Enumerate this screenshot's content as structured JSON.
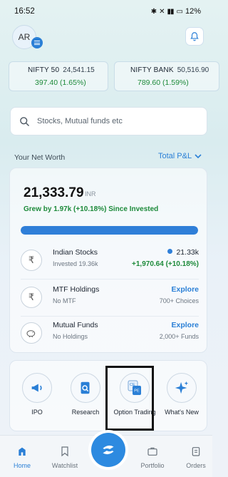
{
  "status_bar": {
    "time": "16:52",
    "battery": "12%"
  },
  "header": {
    "avatar_initials": "AR"
  },
  "indices": [
    {
      "name": "NIFTY 50",
      "price": "24,541.15",
      "change": "397.40 (1.65%)"
    },
    {
      "name": "NIFTY BANK",
      "price": "50,516.90",
      "change": "789.60 (1.59%)"
    }
  ],
  "search": {
    "placeholder": "Stocks, Mutual funds etc"
  },
  "net_worth": {
    "label": "Your Net Worth",
    "toggle": "Total P&L",
    "value": "21,333.79",
    "unit": "INR",
    "growth": "Grew by 1.97k (+10.18%) Since Invested",
    "bar_fraction": 1.0
  },
  "holdings": [
    {
      "title": "Indian Stocks",
      "sub": "Invested 19.36k",
      "right_top": "21.33k",
      "right_bottom": "+1,970.64 (+10.18%)"
    },
    {
      "title": "MTF Holdings",
      "sub": "No MTF",
      "right_top": "Explore",
      "right_bottom": "700+ Choices"
    },
    {
      "title": "Mutual Funds",
      "sub": "No Holdings",
      "right_top": "Explore",
      "right_bottom": "2,000+ Funds"
    }
  ],
  "quick_actions": [
    {
      "label": "IPO"
    },
    {
      "label": "Research"
    },
    {
      "label": "Option Trading"
    },
    {
      "label": "What's New"
    }
  ],
  "option_icon_text": {
    "top": "CE",
    "bottom": "PE"
  },
  "bottom_nav": [
    {
      "label": "Home"
    },
    {
      "label": "Watchlist"
    },
    {
      "label": "Portfolio"
    },
    {
      "label": "Orders"
    }
  ],
  "colors": {
    "accent": "#2a7fd6",
    "positive": "#1d8a3a"
  }
}
